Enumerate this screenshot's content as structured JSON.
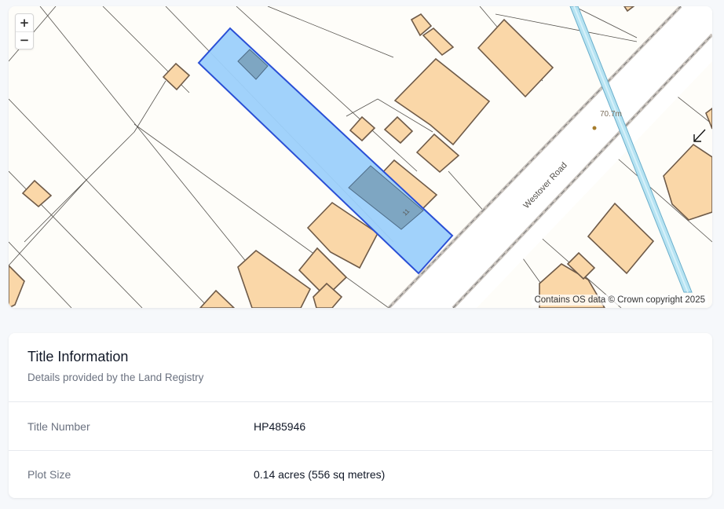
{
  "map": {
    "zoom_in_label": "+",
    "zoom_out_label": "−",
    "road_name": "Westover Road",
    "spot_height": "70.7m",
    "house_number": "11",
    "attribution": "Contains OS data © Crown copyright 2025",
    "colors": {
      "background": "#fefdf9",
      "building": "#fad7a8",
      "building_stroke": "#6e5a48",
      "highlight_fill": "#9cd0fb",
      "highlight_stroke": "#2a4fd6",
      "railway": "#a9dcef"
    }
  },
  "title_info": {
    "title": "Title Information",
    "subtitle": "Details provided by the Land Registry",
    "rows": [
      {
        "label": "Title Number",
        "value": "HP485946"
      },
      {
        "label": "Plot Size",
        "value": "0.14 acres (556 sq metres)"
      }
    ]
  }
}
